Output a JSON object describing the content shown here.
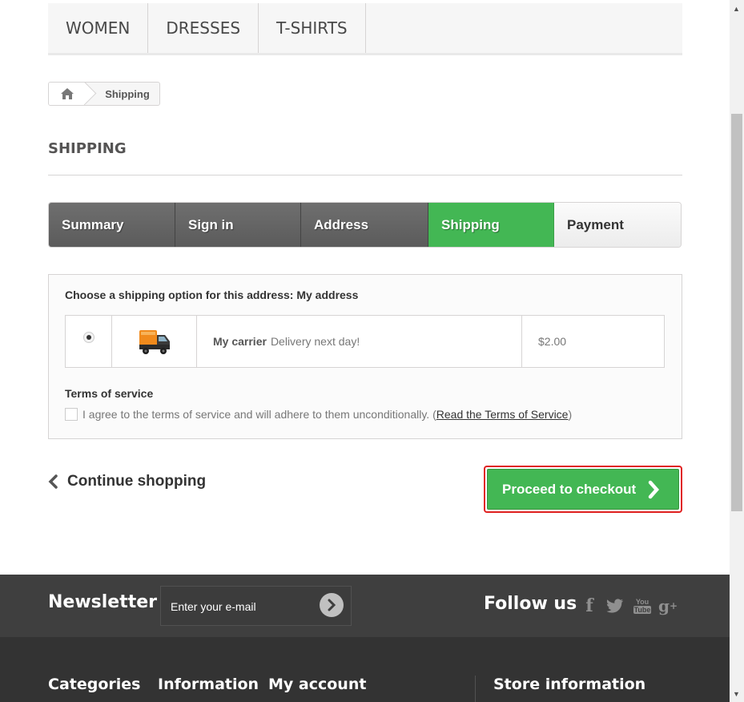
{
  "top_menu": [
    "WOMEN",
    "DRESSES",
    "T-SHIRTS"
  ],
  "breadcrumb": {
    "current": "Shipping"
  },
  "page_title": "SHIPPING",
  "steps": [
    {
      "label": "Summary",
      "state": "done"
    },
    {
      "label": "Sign in",
      "state": "done"
    },
    {
      "label": "Address",
      "state": "done"
    },
    {
      "label": "Shipping",
      "state": "current"
    },
    {
      "label": "Payment",
      "state": "todo"
    }
  ],
  "shipping": {
    "choose_label": "Choose a shipping option for this address: My address",
    "carrier_name": "My carrier",
    "carrier_delay": "Delivery next day!",
    "price": "$2.00",
    "selected": true
  },
  "terms": {
    "title": "Terms of service",
    "agree_text": "I agree to the terms of service and will adhere to them unconditionally.",
    "link_open": "(",
    "link_text": "Read the Terms of Service",
    "link_close": ")",
    "checked": false
  },
  "actions": {
    "continue_label": "Continue shopping",
    "checkout_label": "Proceed to checkout"
  },
  "footer": {
    "newsletter_title": "Newsletter",
    "newsletter_placeholder": "Enter your e-mail",
    "follow_title": "Follow us",
    "social": [
      "facebook-icon",
      "twitter-icon",
      "youtube-icon",
      "google-plus-icon"
    ],
    "columns": [
      "Categories",
      "Information",
      "My account",
      "Store information"
    ]
  },
  "colors": {
    "accent_green": "#43b754",
    "step_done": "#5f5f5f",
    "footer_dark": "#3f3f3f",
    "highlight_border": "#e02020"
  }
}
